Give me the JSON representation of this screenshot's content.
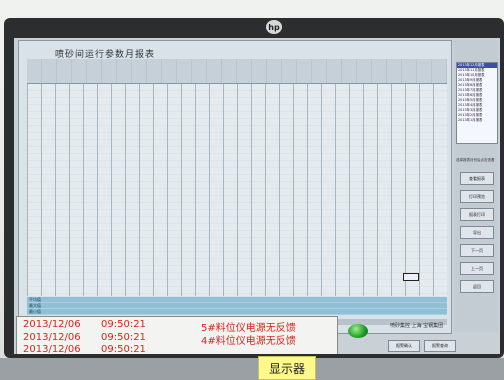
{
  "report": {
    "title": "喷砂间运行参数月报表",
    "row_count": 32,
    "summary_rows": [
      "平均值",
      "最大值",
      "最小值"
    ]
  },
  "sidebar": {
    "list_items": [
      "2013年12月报表",
      "2013年11月报表",
      "2013年10月报表",
      "2013年9月报表",
      "2013年8月报表",
      "2013年7月报表",
      "2013年6月报表",
      "2013年5月报表",
      "2013年4月报表",
      "2013年3月报表",
      "2013年2月报表",
      "2013年1月报表"
    ],
    "selected_index": 0,
    "hint": "选择报表月份后点击查看",
    "buttons": [
      "查看报表",
      "打印预览",
      "报表打印",
      "导出",
      "下一页",
      "上一页",
      "返回"
    ]
  },
  "alarms": [
    {
      "date": "2013/12/06",
      "time": "09:50:21",
      "message": "5#料位仪电源无反馈"
    },
    {
      "date": "2013/12/06",
      "time": "09:50:21",
      "message": "4#料位仪电源无反馈"
    },
    {
      "date": "2013/12/06",
      "time": "09:50:21",
      "message": ""
    }
  ],
  "status": {
    "text": "喷砂集控  上海  宝钢集团",
    "indicator_color": "#1d9b25",
    "buttons": [
      "报警确认",
      "报警查询"
    ]
  },
  "physical_label": "显示器",
  "colors": {
    "alarm_text": "#d8261b",
    "selection": "#3c4fa8",
    "summary_row": "#8fc0d6"
  }
}
